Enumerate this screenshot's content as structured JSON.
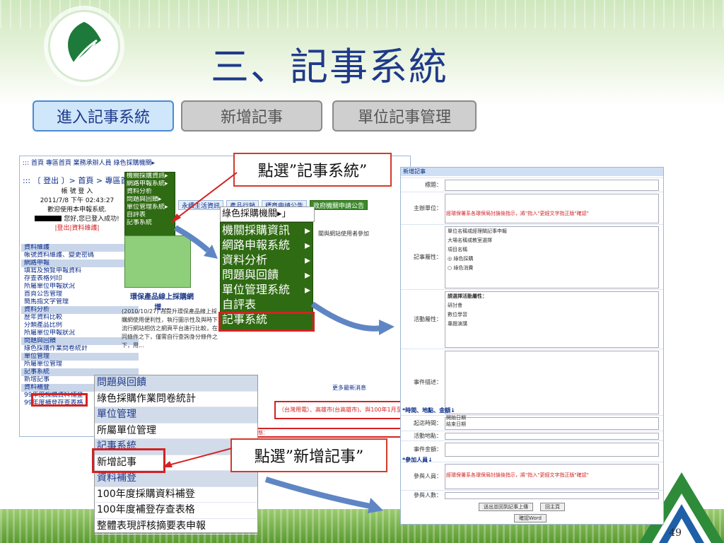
{
  "slide": {
    "title": "三、記事系統",
    "page_number": "49"
  },
  "tabs": [
    {
      "label": "進入記事系統",
      "active": true
    },
    {
      "label": "新增記事",
      "active": false
    },
    {
      "label": "單位記事管理",
      "active": false
    }
  ],
  "callouts": {
    "select_system": "點選”記事系統”",
    "select_new": "點選”新增記事”"
  },
  "left_screenshot": {
    "breadcrumb": "::: 首頁 專區首頁 業務承辦人員 綠色採購機關▸",
    "logout_line": "::: 〔 登出 〕> 首頁 > 專區首",
    "login_box": {
      "title": "帳 號 登 入",
      "datetime": "2011/7/8 下午 02:43:27",
      "welcome": "歡迎使用本申報系統.",
      "success": "您好,您已登入成功!",
      "links": "|登出|資料維護|"
    },
    "sidebar": [
      {
        "text": "資料維護",
        "head": true
      },
      {
        "text": "帳號資料維護、變更密碼",
        "head": false
      },
      {
        "text": "網路申報",
        "head": true
      },
      {
        "text": "填寫及預覽申報資料",
        "head": false
      },
      {
        "text": "存查表格列印",
        "head": false
      },
      {
        "text": "所屬單位申報狀況",
        "head": false
      },
      {
        "text": "首頁公告管理",
        "head": false
      },
      {
        "text": "簡馬指文字管理",
        "head": false
      },
      {
        "text": "資料分析",
        "head": true
      },
      {
        "text": "歷年資料比較",
        "head": false
      },
      {
        "text": "分類產品比例",
        "head": false
      },
      {
        "text": "所屬單位申報狀況",
        "head": false
      },
      {
        "text": "問題與回饋",
        "head": true
      },
      {
        "text": "綠色採購作業問卷統計",
        "head": false
      },
      {
        "text": "單位管理",
        "head": true
      },
      {
        "text": "所屬單位管理",
        "head": false
      },
      {
        "text": "記事系統",
        "head": true
      },
      {
        "text": "新增記事",
        "head": false
      },
      {
        "text": "資料補登",
        "head": true
      },
      {
        "text": "99年度採購資料補登",
        "head": false
      },
      {
        "text": "99年度補登存查表格",
        "head": false
      }
    ],
    "small_menu": [
      "機關採購資訊▸",
      "網路申報系統▸",
      "資料分析",
      "問題與回饋▸",
      "單位管理系統▸",
      "自評表",
      "記事系統"
    ],
    "content_tabs": [
      "永續生活資訊",
      "產品行銷",
      "標章申請公告",
      "政府機關申請公告"
    ],
    "news_title": "環保產品線上採購網",
    "news_sub": "增...",
    "news_body": "(2010/10/27) 為提升環保產品線上採購網使用便利性，執行圖示性及與時下流行網站相仿之網頁平台進行比較，在同條件之下，僅需自行查詢身分條件之下，用...",
    "more_link": "更多最新消息",
    "ticker": "（台灣用電）、高雄市(台高雄市)、與100年1月至",
    "red_notice": "產業動態：",
    "users_note": "關與網站使用者參加"
  },
  "big_menu": {
    "header": "綠色採購機關▸」",
    "items": [
      {
        "label": "機關採購資訊",
        "arrow": "▸"
      },
      {
        "label": "網路申報系統",
        "arrow": "▸"
      },
      {
        "label": "資料分析",
        "arrow": "▸"
      },
      {
        "label": "問題與回饋",
        "arrow": "▸"
      },
      {
        "label": "單位管理系統",
        "arrow": "▸"
      },
      {
        "label": "自評表",
        "arrow": ""
      },
      {
        "label": "記事系統",
        "arrow": ""
      }
    ]
  },
  "list_panel": [
    {
      "text": "問題與回饋",
      "head": true
    },
    {
      "text": "綠色採購作業問卷統計",
      "head": false
    },
    {
      "text": "單位管理",
      "head": true
    },
    {
      "text": "所屬單位管理",
      "head": false
    },
    {
      "text": "記事系統",
      "head": true
    },
    {
      "text": "新增記事",
      "head": false
    },
    {
      "text": "資料補登",
      "head": true
    },
    {
      "text": "100年度採購資料補登",
      "head": false
    },
    {
      "text": "100年度補登存查表格",
      "head": false
    },
    {
      "text": "整體表現評核摘要表申報",
      "head": false
    }
  ],
  "right_screenshot": {
    "header": "新增記事",
    "rows": [
      {
        "label": "標題："
      },
      {
        "label": "主辦單位："
      },
      {
        "label": "記事屬性："
      },
      {
        "label": "活動屬性："
      },
      {
        "label": "事件描述："
      },
      {
        "label": "起迄時間："
      },
      {
        "label": "活動地點："
      },
      {
        "label": "事件金額："
      },
      {
        "label": "參與人員："
      },
      {
        "label": "參與人數："
      }
    ],
    "section_time": "*時間、地點、金額↓",
    "section_people": "*參加人員↓",
    "red_hint": "經環保署系各環保局討論後指示，將\"指入\"更經文字指正版\"確認\"",
    "attr_options": [
      "單位名稱或經理關記事申報",
      "大場名稱或教室選擇",
      "項目名稱",
      "◎ 綠色採購",
      "○ 綠色消費"
    ],
    "activity_title": "請選擇活動屬性：",
    "activity_options": [
      "研討會",
      "數位學習",
      "專題演講"
    ],
    "start_label": "開始日期",
    "end_label": "結束日期",
    "buttons": [
      "送出並回到記事上傳",
      "回主頁"
    ],
    "footer_button": "確認Word"
  },
  "colors": {
    "title_blue": "#1f3a8a",
    "menu_green": "#2f6b12",
    "highlight_red": "#d42222",
    "tab_active_bg": "#cfe6fb"
  }
}
